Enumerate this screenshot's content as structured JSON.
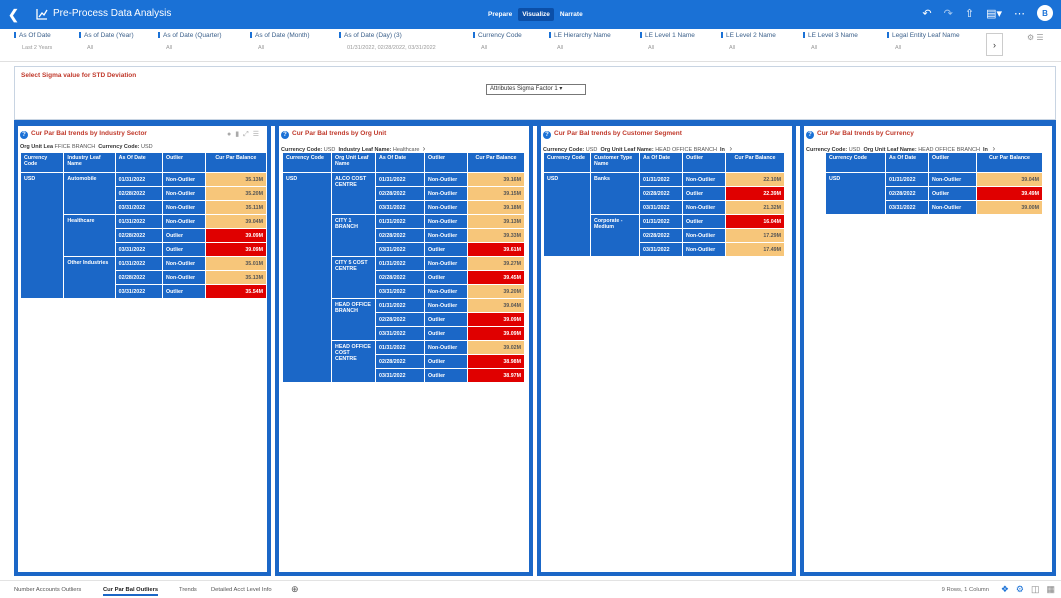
{
  "app": {
    "title": "Pre-Process Data Analysis",
    "modes": [
      "Prepare",
      "Visualize",
      "Narrate"
    ],
    "active_mode": "Visualize",
    "user_initial": "B"
  },
  "filters": [
    {
      "label": "As Of Date",
      "value": "Last 2 Years"
    },
    {
      "label": "As of Date (Year)",
      "value": "All"
    },
    {
      "label": "As of Date (Quarter)",
      "value": "All"
    },
    {
      "label": "As of Date (Month)",
      "value": "All"
    },
    {
      "label": "As of Date (Day) (3)",
      "value": "01/31/2022, 02/28/2022, 03/31/2022"
    },
    {
      "label": "Currency Code",
      "value": "All"
    },
    {
      "label": "LE Hierarchy Name",
      "value": "All"
    },
    {
      "label": "LE Level 1 Name",
      "value": "All"
    },
    {
      "label": "LE Level 2 Name",
      "value": "All"
    },
    {
      "label": "LE Level 3 Name",
      "value": "All"
    },
    {
      "label": "Legal Entity Leaf Name",
      "value": "All"
    }
  ],
  "sigma": {
    "label": "Select Sigma value for STD Deviation",
    "selected": "Attributes Sigma Factor 1"
  },
  "panels": [
    {
      "title": "Cur Par Bal trends by Industry Sector",
      "subtitle": [
        {
          "k": "Org Unit Lea",
          "v": "FFICE BRANCH"
        },
        {
          "k": "Currency Code:",
          "v": "USD"
        }
      ],
      "headers": [
        "Currency Code",
        "Industry Leaf Name",
        "As Of Date",
        "Outlier",
        "Cur Par Balance"
      ],
      "currency": "USD",
      "groups": [
        {
          "name": "Automobile",
          "rows": [
            [
              "01/31/2022",
              "Non-Outlier",
              "35.13M",
              false
            ],
            [
              "02/28/2022",
              "Non-Outlier",
              "35.20M",
              false
            ],
            [
              "03/31/2022",
              "Non-Outlier",
              "35.11M",
              false
            ]
          ]
        },
        {
          "name": "Healthcare",
          "rows": [
            [
              "01/31/2022",
              "Non-Outlier",
              "39.04M",
              false
            ],
            [
              "02/28/2022",
              "Outlier",
              "39.09M",
              true
            ],
            [
              "03/31/2022",
              "Outlier",
              "39.09M",
              true
            ]
          ]
        },
        {
          "name": "Other Industries",
          "rows": [
            [
              "01/31/2022",
              "Non-Outlier",
              "35.01M",
              false
            ],
            [
              "02/28/2022",
              "Non-Outlier",
              "35.13M",
              false
            ],
            [
              "03/31/2022",
              "Outlier",
              "35.54M",
              true
            ]
          ]
        }
      ]
    },
    {
      "title": "Cur Par Bal trends by Org Unit",
      "subtitle": [
        {
          "k": "Currency Code:",
          "v": "USD"
        },
        {
          "k": "Industry Leaf Name:",
          "v": "Healthcare"
        }
      ],
      "headers": [
        "Currency Code",
        "Org Unit Leaf Name",
        "As Of Date",
        "Outlier",
        "Cur Par Balance"
      ],
      "currency": "USD",
      "groups": [
        {
          "name": "ALCO COST CENTRE",
          "rows": [
            [
              "01/31/2022",
              "Non-Outlier",
              "39.16M",
              false
            ],
            [
              "02/28/2022",
              "Non-Outlier",
              "39.15M",
              false
            ],
            [
              "03/31/2022",
              "Non-Outlier",
              "39.18M",
              false
            ]
          ]
        },
        {
          "name": "CITY 1 BRANCH",
          "rows": [
            [
              "01/31/2022",
              "Non-Outlier",
              "39.13M",
              false
            ],
            [
              "02/28/2022",
              "Non-Outlier",
              "39.33M",
              false
            ],
            [
              "03/31/2022",
              "Outlier",
              "39.61M",
              true
            ]
          ]
        },
        {
          "name": "CITY 5 COST CENTRE",
          "rows": [
            [
              "01/31/2022",
              "Non-Outlier",
              "39.27M",
              false
            ],
            [
              "02/28/2022",
              "Outlier",
              "39.45M",
              true
            ],
            [
              "03/31/2022",
              "Non-Outlier",
              "39.20M",
              false
            ]
          ]
        },
        {
          "name": "HEAD OFFICE BRANCH",
          "rows": [
            [
              "01/31/2022",
              "Non-Outlier",
              "39.04M",
              false
            ],
            [
              "02/28/2022",
              "Outlier",
              "39.09M",
              true
            ],
            [
              "03/31/2022",
              "Outlier",
              "39.09M",
              true
            ]
          ]
        },
        {
          "name": "HEAD OFFICE COST CENTRE",
          "rows": [
            [
              "01/31/2022",
              "Non-Outlier",
              "39.02M",
              false
            ],
            [
              "02/28/2022",
              "Outlier",
              "38.98M",
              true
            ],
            [
              "03/31/2022",
              "Outlier",
              "38.97M",
              true
            ]
          ]
        }
      ]
    },
    {
      "title": "Cur Par Bal trends by Customer Segment",
      "subtitle": [
        {
          "k": "Currency Code:",
          "v": "USD"
        },
        {
          "k": "Org Unit Leaf Name:",
          "v": "HEAD OFFICE BRANCH"
        },
        {
          "k": "In",
          "v": ""
        }
      ],
      "headers": [
        "Currency Code",
        "Customer Type Name",
        "As Of Date",
        "Outlier",
        "Cur Par Balance"
      ],
      "currency": "USD",
      "groups": [
        {
          "name": "Banks",
          "rows": [
            [
              "01/31/2022",
              "Non-Outlier",
              "22.10M",
              false
            ],
            [
              "02/28/2022",
              "Outlier",
              "22.39M",
              true
            ],
            [
              "03/31/2022",
              "Non-Outlier",
              "21.32M",
              false
            ]
          ]
        },
        {
          "name": "Corporate - Medium",
          "rows": [
            [
              "01/31/2022",
              "Outlier",
              "16.04M",
              true
            ],
            [
              "02/28/2022",
              "Non-Outlier",
              "17.29M",
              false
            ],
            [
              "03/31/2022",
              "Non-Outlier",
              "17.49M",
              false
            ]
          ]
        }
      ]
    },
    {
      "title": "Cur Par Bal trends by Currency",
      "subtitle": [
        {
          "k": "Currency Code:",
          "v": "USD"
        },
        {
          "k": "Org Unit Leaf Name:",
          "v": "HEAD OFFICE BRANCH"
        },
        {
          "k": "In",
          "v": ""
        }
      ],
      "headers": [
        "Currency Code",
        "As Of Date",
        "Outlier",
        "Cur Par Balance"
      ],
      "currency": "USD",
      "groups": [
        {
          "name": "",
          "rows": [
            [
              "01/31/2022",
              "Non-Outlier",
              "39.04M",
              false
            ],
            [
              "02/28/2022",
              "Outlier",
              "39.49M",
              true
            ],
            [
              "03/31/2022",
              "Non-Outlier",
              "39.00M",
              false
            ]
          ]
        }
      ]
    }
  ],
  "tabs": [
    "Number Accounts Outliers",
    "Cur Par Bal Outliers",
    "Trends",
    "Detailed Acct Level Info"
  ],
  "active_tab": "Cur Par Bal Outliers",
  "status": "9 Rows, 1 Column"
}
